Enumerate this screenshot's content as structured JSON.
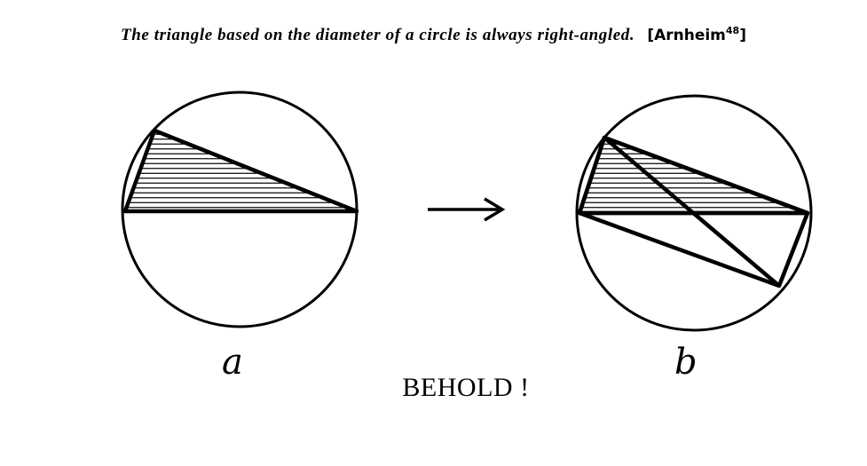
{
  "caption": "The triangle based on the diameter of a circle is always right-angled.",
  "citation": {
    "author": "[Arnheim",
    "ref": "48",
    "close": "]"
  },
  "figures": {
    "a": {
      "label": "a"
    },
    "b": {
      "label": "b"
    }
  },
  "footer": "BEHOLD !",
  "colors": {
    "ink": "#000000",
    "paper": "#ffffff"
  }
}
